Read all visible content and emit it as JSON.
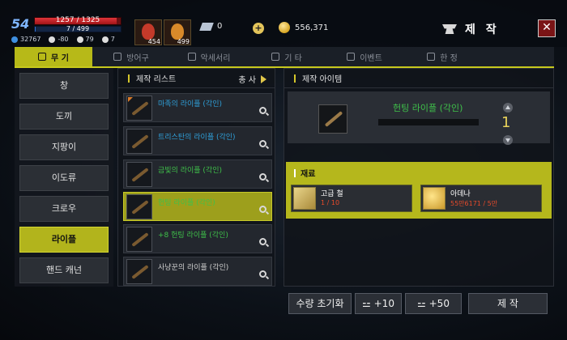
{
  "player": {
    "level": "54",
    "hp": "1257 / 1325",
    "mp": "7 / 499",
    "hp_fraction": 0.949,
    "mp_fraction": 0.014,
    "stats": [
      "32767",
      "-80",
      "79",
      "7"
    ]
  },
  "potions": [
    {
      "count": "454",
      "color": "#c43a2a"
    },
    {
      "count": "499",
      "color": "#d8892a"
    }
  ],
  "currency": {
    "crystal": "0",
    "gold": "556,371"
  },
  "header": {
    "title": "제 작",
    "close_icon": "close-icon"
  },
  "tabs": [
    {
      "label": "무 기",
      "active": true
    },
    {
      "label": "방어구"
    },
    {
      "label": "악세서리"
    },
    {
      "label": "기 타"
    },
    {
      "label": "이벤트"
    },
    {
      "label": "한 정"
    }
  ],
  "categories": [
    "창",
    "도끼",
    "지팡이",
    "이도류",
    "크로우",
    "라이플",
    "핸드 캐넌"
  ],
  "active_category": "라이플",
  "list": {
    "title": "제작 리스트",
    "sort_label": "총 사",
    "items": [
      {
        "name": "마족의 라이플 (각인)",
        "color": "blue"
      },
      {
        "name": "트리스탄의 라이플 (각인)",
        "color": "blue"
      },
      {
        "name": "금빛의 라이플 (각인)",
        "color": "green"
      },
      {
        "name": "헌팅 라이플 (각인)",
        "color": "green",
        "active": true
      },
      {
        "name": "+8 헌팅 라이플 (각인)",
        "color": "green"
      },
      {
        "name": "사냥꾼의 라이플 (각인)",
        "color": "gray"
      }
    ]
  },
  "detail": {
    "title": "제작 아이템",
    "item_name": "헌팅 라이플 (각인)",
    "quantity": "1",
    "materials_title": "재료",
    "materials": [
      {
        "name": "고급 철",
        "qty": "1 / 10"
      },
      {
        "name": "아데나",
        "qty": "55만6171 / 5만"
      }
    ]
  },
  "buttons": {
    "reset": "수량 초기화",
    "plus10": "+10",
    "plus50": "+50",
    "craft": "제 작"
  }
}
